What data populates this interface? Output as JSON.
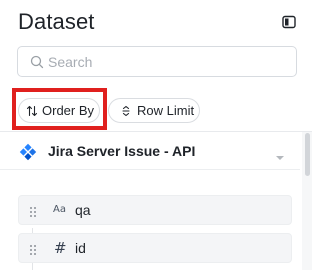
{
  "panel": {
    "title": "Dataset",
    "collapse_icon": "sidebar-collapse-icon"
  },
  "search": {
    "placeholder": "Search",
    "value": "",
    "icon": "search-icon"
  },
  "controls": {
    "order_by": {
      "label": "Order By",
      "icon": "sort-arrows-icon",
      "highlighted": true,
      "highlight_color": "#e0201e"
    },
    "row_limit": {
      "label": "Row Limit",
      "icon": "row-limit-icon"
    }
  },
  "source": {
    "name": "Jira Server Issue - API",
    "icon": "jira-icon",
    "brand_color": "#2684ff",
    "toggle_icon": "chevron-down-icon"
  },
  "columns": [
    {
      "name": "qa",
      "type_icon": "Aa",
      "type": "string"
    },
    {
      "name": "id",
      "type_icon": "#",
      "type": "number"
    }
  ]
}
